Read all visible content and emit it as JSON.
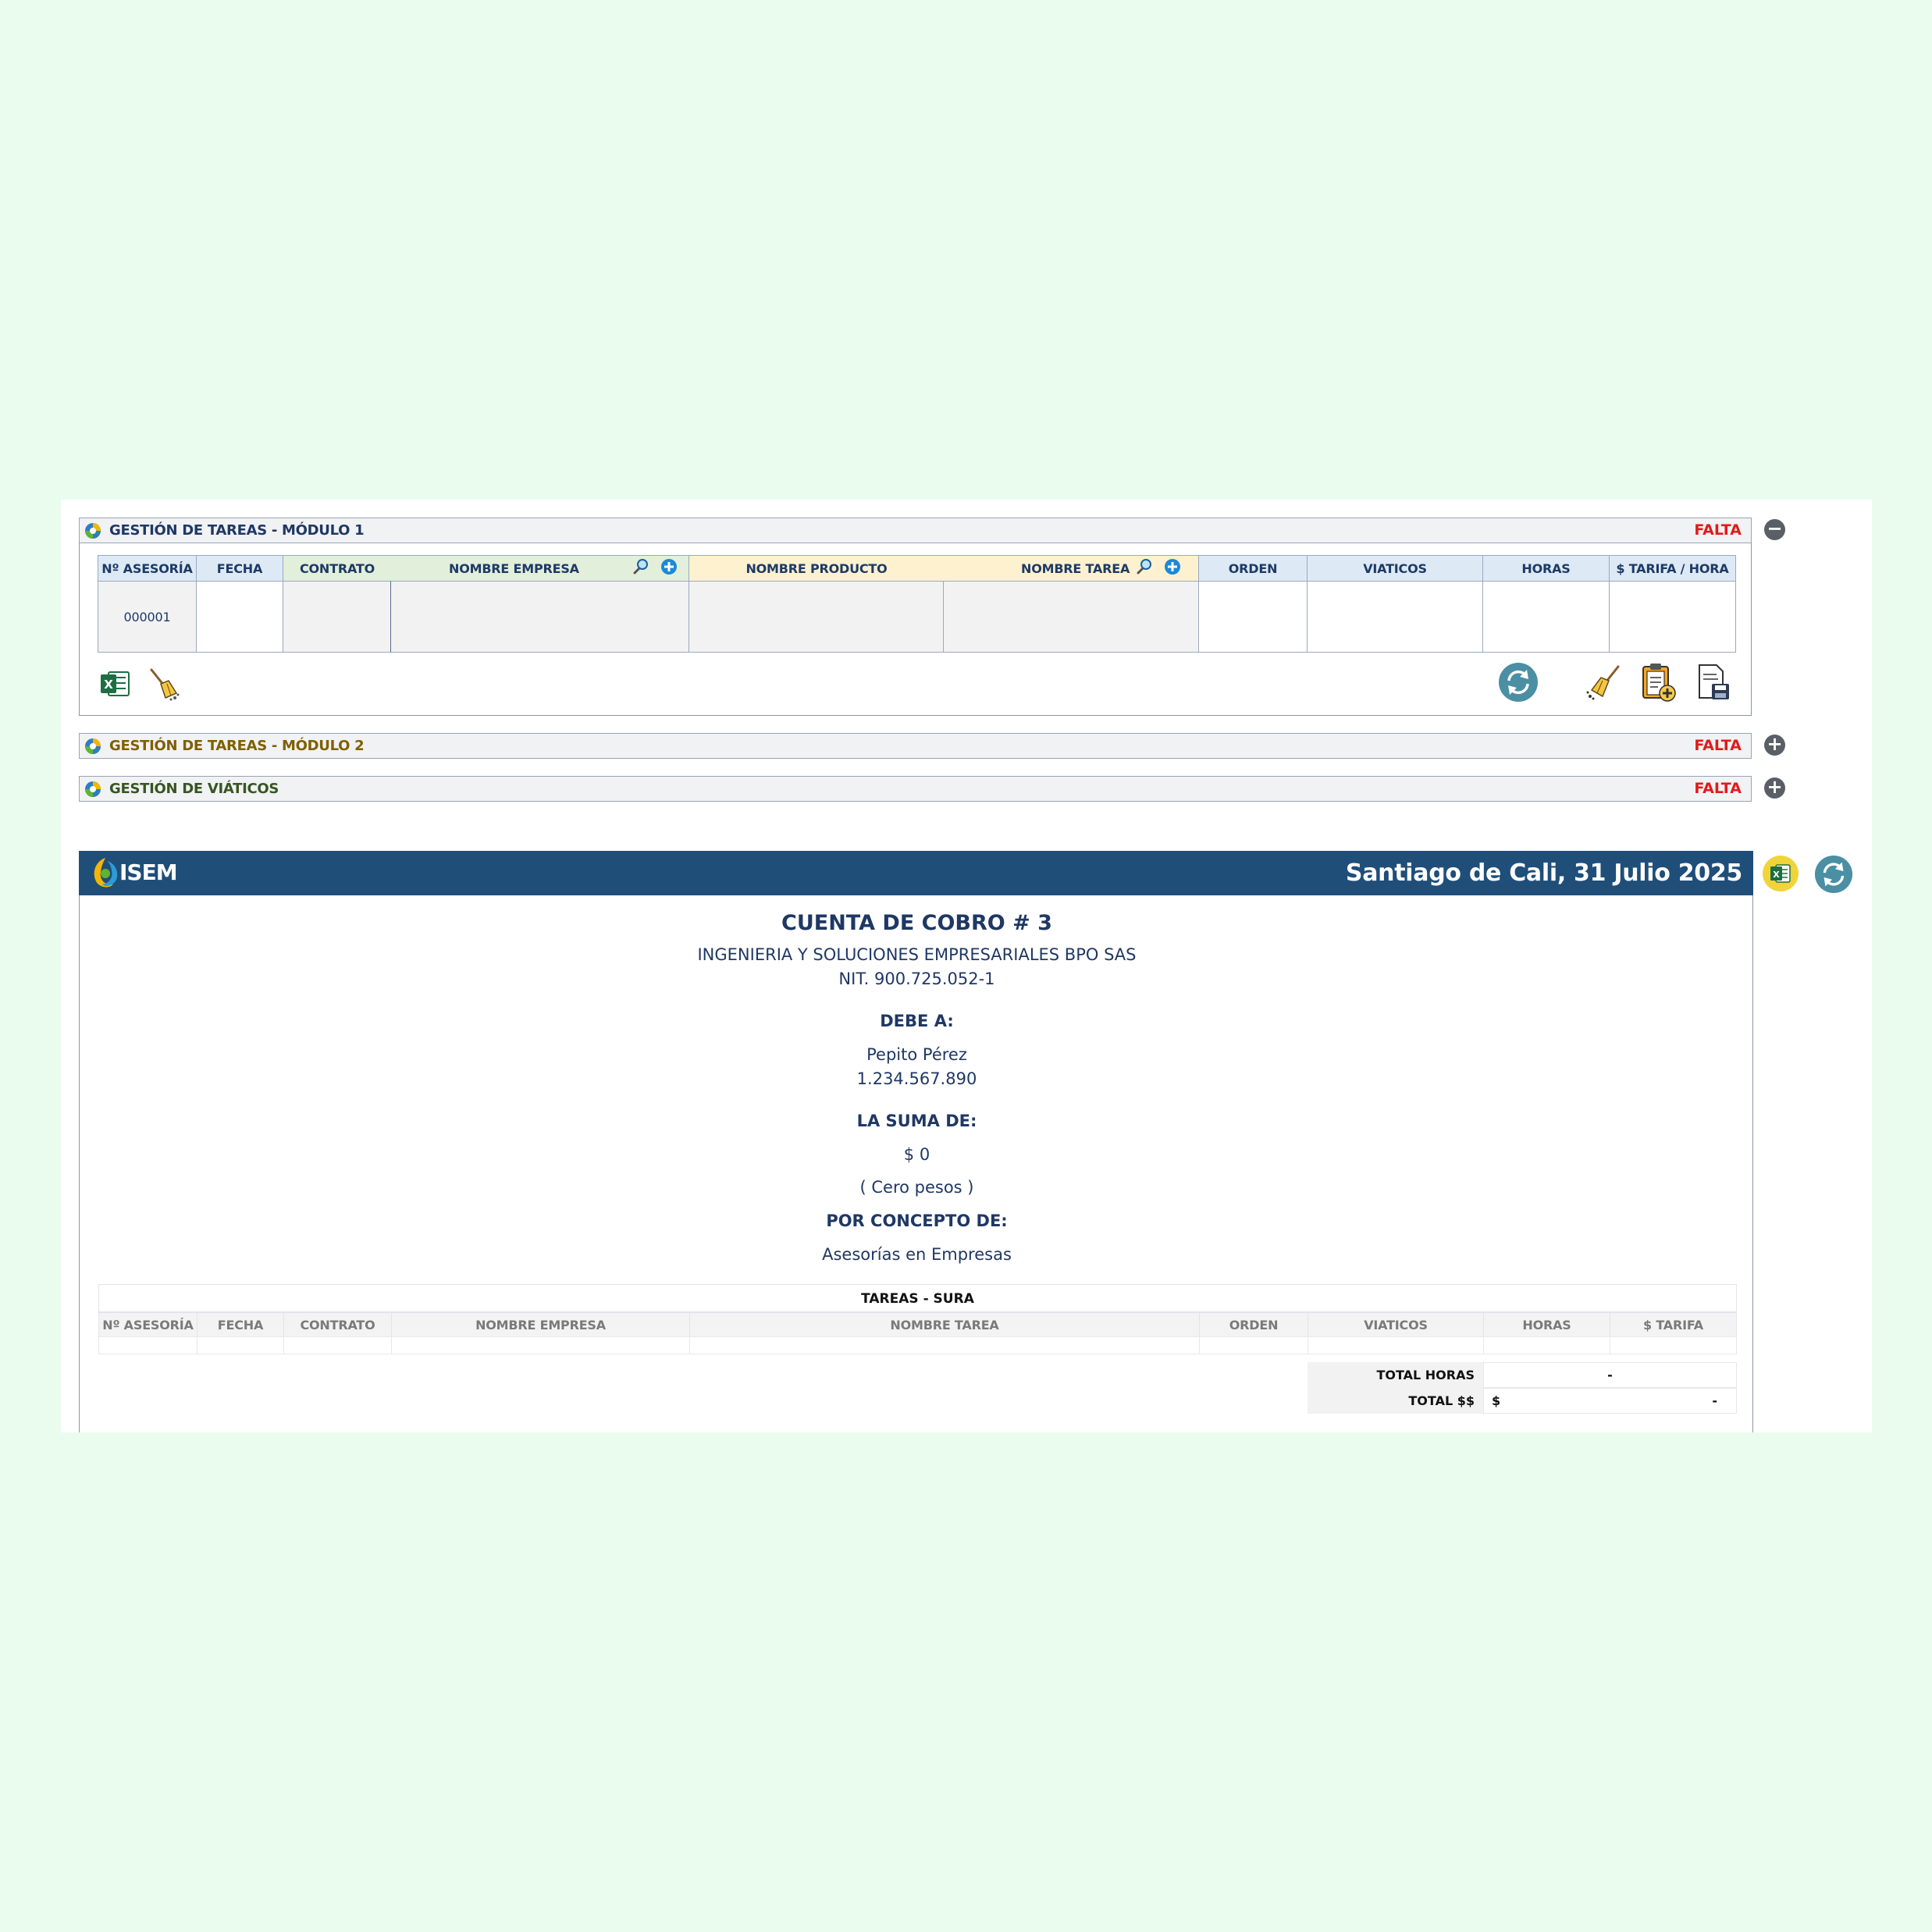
{
  "module1": {
    "title": "GESTIÓN DE TAREAS - MÓDULO 1",
    "status": "FALTA",
    "toggle": "−",
    "columns": {
      "asesoria": "Nº ASESORÍA",
      "fecha": "FECHA",
      "contrato": "CONTRATO",
      "empresa": "NOMBRE EMPRESA",
      "producto": "NOMBRE PRODUCTO",
      "tarea": "NOMBRE TAREA",
      "orden": "ORDEN",
      "viaticos": "VIATICOS",
      "horas": "HORAS",
      "tarifa": "$ TARIFA / HORA"
    },
    "row": {
      "asesoria": "000001"
    }
  },
  "module2": {
    "title": "GESTIÓN DE TAREAS - MÓDULO 2",
    "status": "FALTA",
    "toggle": "+"
  },
  "viaticos": {
    "title": "GESTIÓN DE VIÁTICOS",
    "status": "FALTA",
    "toggle": "+"
  },
  "colors": {
    "status": "#e01b1b",
    "module1_title": "#1f3864",
    "module2_title": "#7f6000",
    "viaticos_title": "#375623",
    "invoice_header": "#1f4e79"
  },
  "icons": {
    "toolbar_left": [
      "excel-icon",
      "broom-icon"
    ],
    "toolbar_right": [
      "refresh-icon",
      "broom-icon",
      "clipboard-add-icon",
      "save-document-icon"
    ],
    "grid": [
      "search-icon",
      "add-circle-icon"
    ]
  },
  "invoice": {
    "logo_text": "ISEM",
    "date": "Santiago de Cali, 31 Julio 2025",
    "title": "CUENTA DE COBRO # 3",
    "company": "INGENIERIA Y SOLUCIONES EMPRESARIALES BPO SAS",
    "nit": "NIT. 900.725.052-1",
    "owed_label": "DEBE A:",
    "person": "Pepito Pérez",
    "person_id": "1.234.567.890",
    "sum_label": "LA SUMA DE:",
    "amount": "$ 0",
    "amount_words": "( Cero pesos )",
    "concept_label": "POR CONCEPTO DE:",
    "concept": "Asesorías en Empresas",
    "table_title": "TAREAS - SURA",
    "columns": {
      "asesoria": "Nº ASESORÍA",
      "fecha": "FECHA",
      "contrato": "CONTRATO",
      "empresa": "NOMBRE EMPRESA",
      "tarea": "NOMBRE TAREA",
      "orden": "ORDEN",
      "viaticos": "VIATICOS",
      "horas": "HORAS",
      "tarifa": "$ TARIFA"
    },
    "total_hours_label": "TOTAL HORAS",
    "total_hours_value": "-",
    "total_money_label": "TOTAL $$",
    "total_money_currency": "$",
    "total_money_value": "-"
  }
}
